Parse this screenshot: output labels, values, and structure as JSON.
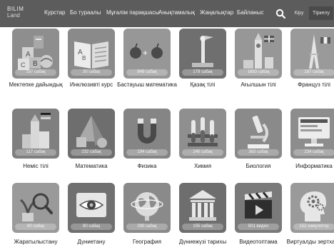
{
  "header": {
    "logo_line1": "BILIM",
    "logo_line2": "Land",
    "nav": [
      "Курстар",
      "Бо тураалы",
      "Мұғалім парақшасы",
      "Анықтамалық",
      "Жаңалықтар",
      "Байланыс"
    ],
    "login": "Кіру",
    "register": "Тіркелу",
    "search_icon": "search-icon"
  },
  "courses": [
    {
      "label": "Мектепке дайындық",
      "count": "157 сабақ",
      "icon": "abc-blocks-icon",
      "color": "#8e8e8e"
    },
    {
      "label": "Инклюзивті курс",
      "count": "30 сабақ",
      "icon": "open-book-icon",
      "color": "#8a8a8a"
    },
    {
      "label": "Бастауыш математика",
      "count": "849 сабақ",
      "icon": "apples-math-icon",
      "color": "#979797"
    },
    {
      "label": "Қазақ тілі",
      "count": "179 сабақ",
      "icon": "kazakh-monument-icon",
      "color": "#6f6f6f"
    },
    {
      "label": "Ағылшын тілі",
      "count": "1683 сабақ",
      "icon": "big-ben-icon",
      "color": "#979797"
    },
    {
      "label": "Француз тілі",
      "count": "187 сабақ",
      "icon": "eiffel-tower-icon",
      "color": "#9a9a9a"
    },
    {
      "label": "Неміс тілі",
      "count": "117 сабақ",
      "icon": "german-castle-icon",
      "color": "#7f7f7f"
    },
    {
      "label": "Математика",
      "count": "232 сабақ",
      "icon": "geometric-shapes-icon",
      "color": "#6e6e6e"
    },
    {
      "label": "Физика",
      "count": "194 сабақ",
      "icon": "magnet-icon",
      "color": "#858585"
    },
    {
      "label": "Химия",
      "count": "240 сабақ",
      "icon": "test-tubes-icon",
      "color": "#8f8f8f"
    },
    {
      "label": "Биология",
      "count": "383 сабақ",
      "icon": "microscope-icon",
      "color": "#8a8a8a"
    },
    {
      "label": "Информатика",
      "count": "234 сабақ",
      "icon": "computer-icon",
      "color": "#8d8d8d"
    },
    {
      "label": "Жаратылыстану",
      "count": "60 сабақ",
      "icon": "magnifier-plant-icon",
      "color": "#9a9a9a"
    },
    {
      "label": "Дүниетану",
      "count": "80 сабақ",
      "icon": "eye-icon",
      "color": "#707070"
    },
    {
      "label": "География",
      "count": "290 сабақ",
      "icon": "globe-icon",
      "color": "#8a8a8a"
    },
    {
      "label": "Дүниежүзі тарихы",
      "count": "155 сабақ",
      "icon": "museum-columns-icon",
      "color": "#6e6e6e"
    },
    {
      "label": "Видеотоптама",
      "count": "501 видео",
      "icon": "clapperboard-icon",
      "color": "#7a7a7a"
    },
    {
      "label": "Виртуалды зертхана",
      "count": "152 симулятор",
      "icon": "head-gears-icon",
      "color": "#9a9a9a"
    }
  ]
}
